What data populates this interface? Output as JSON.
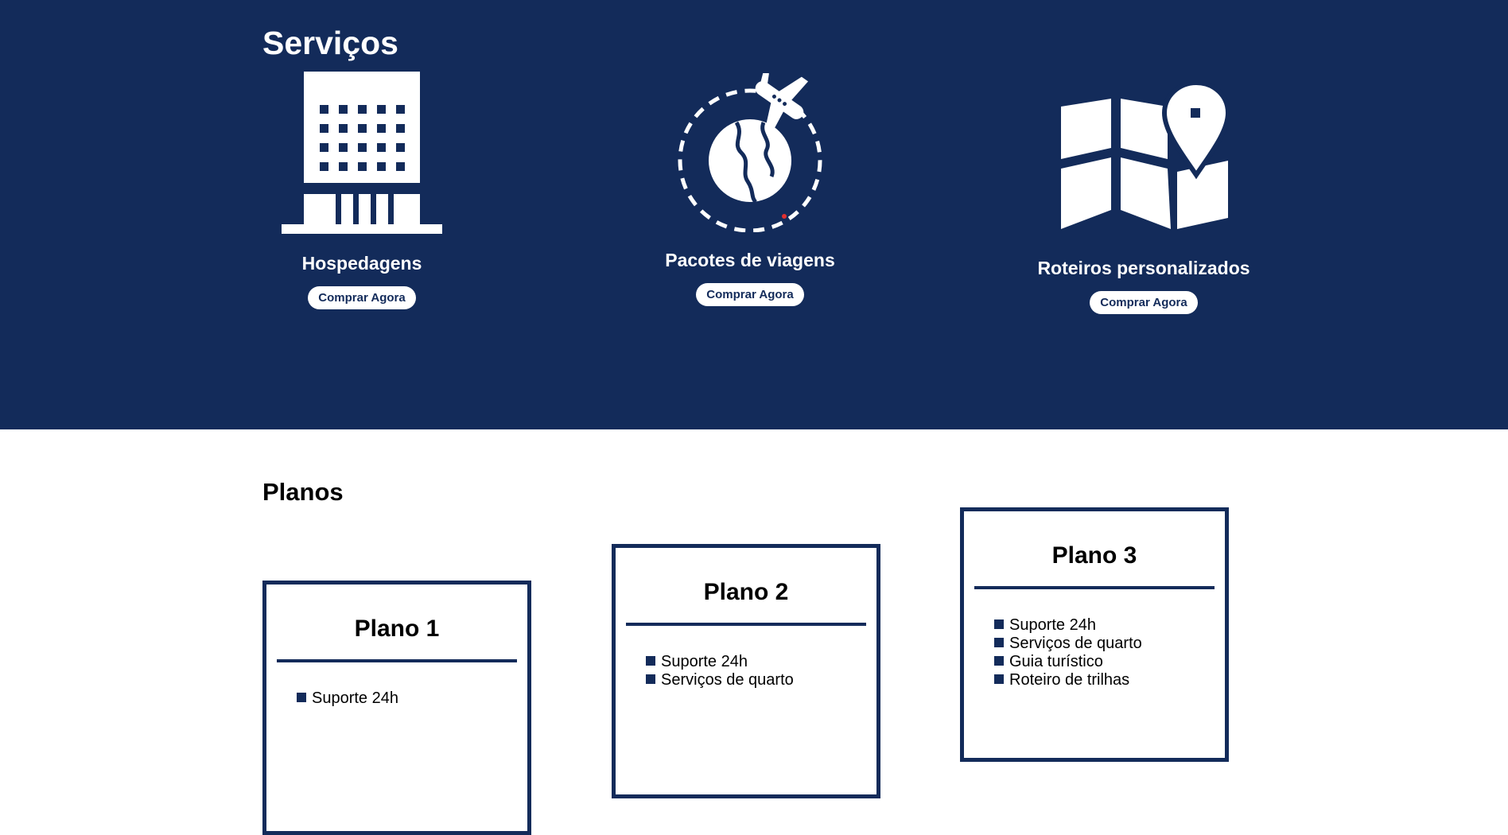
{
  "colors": {
    "brand_navy": "#132b5a",
    "white": "#ffffff"
  },
  "services": {
    "title": "Serviços",
    "items": [
      {
        "name": "Hospedagens",
        "icon": "hotel-building-icon",
        "button": "Comprar Agora"
      },
      {
        "name": "Pacotes de viagens",
        "icon": "globe-airplane-icon",
        "button": "Comprar Agora"
      },
      {
        "name": "Roteiros personalizados",
        "icon": "map-pin-icon",
        "button": "Comprar Agora"
      }
    ]
  },
  "plans": {
    "title": "Planos",
    "items": [
      {
        "title": "Plano 1",
        "features": [
          "Suporte 24h"
        ]
      },
      {
        "title": "Plano 2",
        "features": [
          "Suporte 24h",
          "Serviços de quarto"
        ]
      },
      {
        "title": "Plano 3",
        "features": [
          "Suporte 24h",
          "Serviços de quarto",
          "Guia turístico",
          "Roteiro de trilhas"
        ]
      }
    ]
  }
}
